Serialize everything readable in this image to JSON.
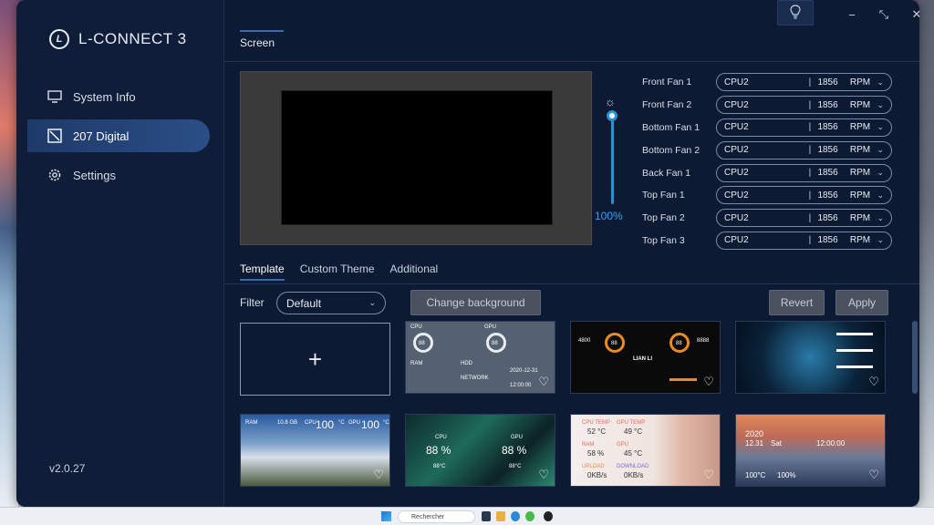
{
  "app": {
    "title": "L-CONNECT 3",
    "version": "v2.0.27"
  },
  "sidebar": {
    "items": [
      {
        "label": "System Info",
        "icon": "monitor-icon",
        "active": false
      },
      {
        "label": "207 Digital",
        "icon": "display-icon",
        "active": true
      },
      {
        "label": "Settings",
        "icon": "gear-icon",
        "active": false
      }
    ]
  },
  "window": {
    "minimize": "−",
    "restore": "⤡",
    "close": "✕"
  },
  "page": {
    "tab": "Screen"
  },
  "brightness": {
    "value": "100%",
    "level": 1.0
  },
  "fans": [
    {
      "label": "Front Fan 1",
      "source": "CPU2",
      "rpm": "1856",
      "unit": "RPM"
    },
    {
      "label": "Front Fan 2",
      "source": "CPU2",
      "rpm": "1856",
      "unit": "RPM"
    },
    {
      "label": "Bottom Fan 1",
      "source": "CPU2",
      "rpm": "1856",
      "unit": "RPM"
    },
    {
      "label": "Bottom Fan 2",
      "source": "CPU2",
      "rpm": "1856",
      "unit": "RPM"
    },
    {
      "label": "Back Fan 1",
      "source": "CPU2",
      "rpm": "1856",
      "unit": "RPM"
    },
    {
      "label": "Top Fan 1",
      "source": "CPU2",
      "rpm": "1856",
      "unit": "RPM"
    },
    {
      "label": "Top Fan 2",
      "source": "CPU2",
      "rpm": "1856",
      "unit": "RPM"
    },
    {
      "label": "Top Fan 3",
      "source": "CPU2",
      "rpm": "1856",
      "unit": "RPM"
    }
  ],
  "tabs": {
    "template": "Template",
    "custom": "Custom Theme",
    "additional": "Additional"
  },
  "filter": {
    "label": "Filter",
    "value": "Default"
  },
  "buttons": {
    "change_bg": "Change background",
    "revert": "Revert",
    "apply": "Apply"
  },
  "templates": {
    "add": "+",
    "sys": {
      "cpu": "CPU",
      "gpu": "GPU",
      "ram": "RAM",
      "hdd": "HDD",
      "network": "NETWORK",
      "val": "88",
      "date": "2020-12-31",
      "time": "12:00:00"
    },
    "lian": {
      "speed": "4800",
      "cpu_val": "88",
      "gpu_val": "88",
      "gpu_speed": "8888",
      "brand": "LIAN LI"
    },
    "sky": {
      "ram": "RAM",
      "ram_val": "10.8 GB",
      "cpu_temp": "100",
      "gpu_temp": "100",
      "unit": "°C",
      "cpu": "CPU",
      "gpu": "GPU"
    },
    "poly": {
      "cpu": "CPU",
      "gpu": "GPU",
      "cpu_pct": "88 %",
      "gpu_pct": "88 %",
      "cpu_temp": "88°C",
      "gpu_temp": "88°C"
    },
    "cube": {
      "cpu_temp_label": "CPU TEMP",
      "cpu_temp": "52 °C",
      "gpu_temp_label": "GPU TEMP",
      "gpu_temp": "49 °C",
      "ram_label": "RAM",
      "ram": "58 %",
      "gpu_label": "GPU",
      "gpu": "45 °C",
      "upload_label": "UPLOAD",
      "upload": "0KB/s",
      "download_label": "DOWNLOAD",
      "download": "0KB/s"
    },
    "sunset": {
      "date": "2020",
      "day": "12.31",
      "weekday": "Sat",
      "time": "12:00:00",
      "cpu_temp": "100°C",
      "usage": "100%"
    }
  },
  "taskbar": {
    "search": "Rechercher"
  }
}
